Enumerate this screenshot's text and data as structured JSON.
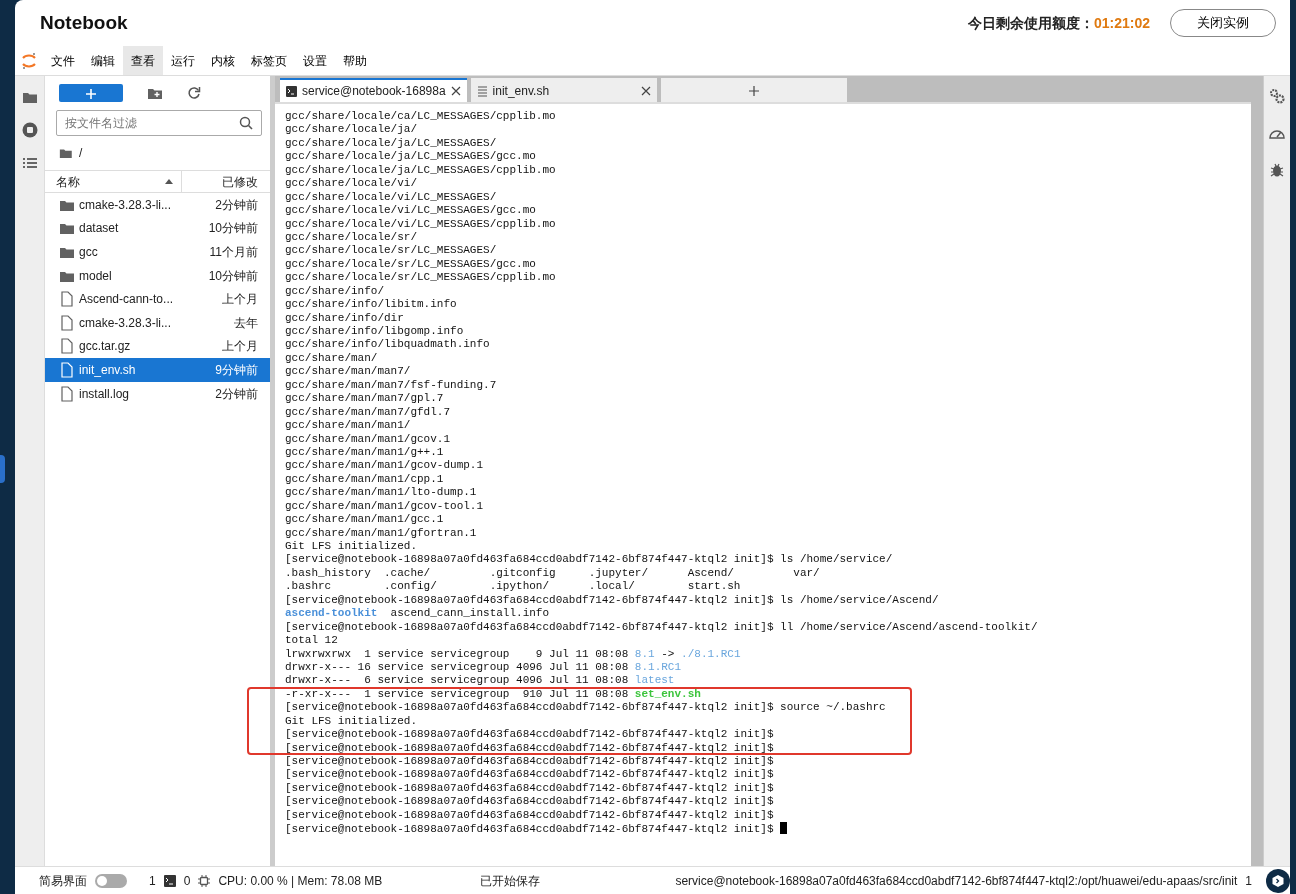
{
  "header": {
    "title": "Notebook",
    "quota_label": "今日剩余使用额度：",
    "quota_value": "01:21:02",
    "close_button": "关闭实例"
  },
  "menu": [
    {
      "label": "文件",
      "selected": false
    },
    {
      "label": "编辑",
      "selected": false
    },
    {
      "label": "查看",
      "selected": true
    },
    {
      "label": "运行",
      "selected": false
    },
    {
      "label": "内核",
      "selected": false
    },
    {
      "label": "标签页",
      "selected": false
    },
    {
      "label": "设置",
      "selected": false
    },
    {
      "label": "帮助",
      "selected": false
    }
  ],
  "file_browser": {
    "filter_placeholder": "按文件名过滤",
    "path": "/",
    "columns": [
      "名称",
      "已修改"
    ],
    "files": [
      {
        "name": "cmake-3.28.3-li...",
        "modified": "2分钟前",
        "kind": "folder",
        "selected": false
      },
      {
        "name": "dataset",
        "modified": "10分钟前",
        "kind": "folder",
        "selected": false
      },
      {
        "name": "gcc",
        "modified": "11个月前",
        "kind": "folder",
        "selected": false
      },
      {
        "name": "model",
        "modified": "10分钟前",
        "kind": "folder",
        "selected": false
      },
      {
        "name": "Ascend-cann-to...",
        "modified": "上个月",
        "kind": "file",
        "selected": false
      },
      {
        "name": "cmake-3.28.3-li...",
        "modified": "去年",
        "kind": "file",
        "selected": false
      },
      {
        "name": "gcc.tar.gz",
        "modified": "上个月",
        "kind": "file",
        "selected": false
      },
      {
        "name": "init_env.sh",
        "modified": "9分钟前",
        "kind": "file",
        "selected": true
      },
      {
        "name": "install.log",
        "modified": "2分钟前",
        "kind": "file",
        "selected": false
      }
    ]
  },
  "tabs": [
    {
      "label": "service@notebook-16898a",
      "kind": "terminal",
      "selected": true
    },
    {
      "label": "init_env.sh",
      "kind": "text",
      "selected": false
    }
  ],
  "terminal": {
    "cursor_visible": true,
    "lines": [
      {
        "highlighted": false,
        "parts": [
          {
            "text": "gcc/share/locale/ca/LC_MESSAGES/cpplib.mo",
            "kind": "plain"
          }
        ]
      },
      {
        "highlighted": false,
        "parts": [
          {
            "text": "gcc/share/locale/ja/",
            "kind": "plain"
          }
        ]
      },
      {
        "highlighted": false,
        "parts": [
          {
            "text": "gcc/share/locale/ja/LC_MESSAGES/",
            "kind": "plain"
          }
        ]
      },
      {
        "highlighted": false,
        "parts": [
          {
            "text": "gcc/share/locale/ja/LC_MESSAGES/gcc.mo",
            "kind": "plain"
          }
        ]
      },
      {
        "highlighted": false,
        "parts": [
          {
            "text": "gcc/share/locale/ja/LC_MESSAGES/cpplib.mo",
            "kind": "plain"
          }
        ]
      },
      {
        "highlighted": false,
        "parts": [
          {
            "text": "gcc/share/locale/vi/",
            "kind": "plain"
          }
        ]
      },
      {
        "highlighted": false,
        "parts": [
          {
            "text": "gcc/share/locale/vi/LC_MESSAGES/",
            "kind": "plain"
          }
        ]
      },
      {
        "highlighted": false,
        "parts": [
          {
            "text": "gcc/share/locale/vi/LC_MESSAGES/gcc.mo",
            "kind": "plain"
          }
        ]
      },
      {
        "highlighted": false,
        "parts": [
          {
            "text": "gcc/share/locale/vi/LC_MESSAGES/cpplib.mo",
            "kind": "plain"
          }
        ]
      },
      {
        "highlighted": false,
        "parts": [
          {
            "text": "gcc/share/locale/sr/",
            "kind": "plain"
          }
        ]
      },
      {
        "highlighted": false,
        "parts": [
          {
            "text": "gcc/share/locale/sr/LC_MESSAGES/",
            "kind": "plain"
          }
        ]
      },
      {
        "highlighted": false,
        "parts": [
          {
            "text": "gcc/share/locale/sr/LC_MESSAGES/gcc.mo",
            "kind": "plain"
          }
        ]
      },
      {
        "highlighted": false,
        "parts": [
          {
            "text": "gcc/share/locale/sr/LC_MESSAGES/cpplib.mo",
            "kind": "plain"
          }
        ]
      },
      {
        "highlighted": false,
        "parts": [
          {
            "text": "gcc/share/info/",
            "kind": "plain"
          }
        ]
      },
      {
        "highlighted": false,
        "parts": [
          {
            "text": "gcc/share/info/libitm.info",
            "kind": "plain"
          }
        ]
      },
      {
        "highlighted": false,
        "parts": [
          {
            "text": "gcc/share/info/dir",
            "kind": "plain"
          }
        ]
      },
      {
        "highlighted": false,
        "parts": [
          {
            "text": "gcc/share/info/libgomp.info",
            "kind": "plain"
          }
        ]
      },
      {
        "highlighted": false,
        "parts": [
          {
            "text": "gcc/share/info/libquadmath.info",
            "kind": "plain"
          }
        ]
      },
      {
        "highlighted": false,
        "parts": [
          {
            "text": "gcc/share/man/",
            "kind": "plain"
          }
        ]
      },
      {
        "highlighted": false,
        "parts": [
          {
            "text": "gcc/share/man/man7/",
            "kind": "plain"
          }
        ]
      },
      {
        "highlighted": false,
        "parts": [
          {
            "text": "gcc/share/man/man7/fsf-funding.7",
            "kind": "plain"
          }
        ]
      },
      {
        "highlighted": false,
        "parts": [
          {
            "text": "gcc/share/man/man7/gpl.7",
            "kind": "plain"
          }
        ]
      },
      {
        "highlighted": false,
        "parts": [
          {
            "text": "gcc/share/man/man7/gfdl.7",
            "kind": "plain"
          }
        ]
      },
      {
        "highlighted": false,
        "parts": [
          {
            "text": "gcc/share/man/man1/",
            "kind": "plain"
          }
        ]
      },
      {
        "highlighted": false,
        "parts": [
          {
            "text": "gcc/share/man/man1/gcov.1",
            "kind": "plain"
          }
        ]
      },
      {
        "highlighted": false,
        "parts": [
          {
            "text": "gcc/share/man/man1/g++.1",
            "kind": "plain"
          }
        ]
      },
      {
        "highlighted": false,
        "parts": [
          {
            "text": "gcc/share/man/man1/gcov-dump.1",
            "kind": "plain"
          }
        ]
      },
      {
        "highlighted": false,
        "parts": [
          {
            "text": "gcc/share/man/man1/cpp.1",
            "kind": "plain"
          }
        ]
      },
      {
        "highlighted": false,
        "parts": [
          {
            "text": "gcc/share/man/man1/lto-dump.1",
            "kind": "plain"
          }
        ]
      },
      {
        "highlighted": false,
        "parts": [
          {
            "text": "gcc/share/man/man1/gcov-tool.1",
            "kind": "plain"
          }
        ]
      },
      {
        "highlighted": false,
        "parts": [
          {
            "text": "gcc/share/man/man1/gcc.1",
            "kind": "plain"
          }
        ]
      },
      {
        "highlighted": false,
        "parts": [
          {
            "text": "gcc/share/man/man1/gfortran.1",
            "kind": "plain"
          }
        ]
      },
      {
        "highlighted": false,
        "parts": [
          {
            "text": "Git LFS initialized.",
            "kind": "plain"
          }
        ]
      },
      {
        "highlighted": false,
        "parts": [
          {
            "text": "[service@notebook-16898a07a0fd463fa684ccd0abdf7142-6bf874f447-ktql2 init]$ ls /home/service/",
            "kind": "plain"
          }
        ]
      },
      {
        "highlighted": false,
        "parts": [
          {
            "text": ".bash_history  .cache/         .gitconfig     .jupyter/      Ascend/         var/",
            "kind": "plain"
          }
        ]
      },
      {
        "highlighted": false,
        "parts": [
          {
            "text": ".bashrc        .config/        .ipython/      .local/        start.sh",
            "kind": "plain"
          }
        ]
      },
      {
        "highlighted": false,
        "parts": [
          {
            "text": "[service@notebook-16898a07a0fd463fa684ccd0abdf7142-6bf874f447-ktql2 init]$ ls /home/service/Ascend/",
            "kind": "plain"
          }
        ]
      },
      {
        "highlighted": false,
        "parts": [
          {
            "text": "ascend-toolkit",
            "kind": "dir"
          },
          {
            "text": "  ascend_cann_install.info",
            "kind": "plain"
          }
        ]
      },
      {
        "highlighted": false,
        "parts": [
          {
            "text": "[service@notebook-16898a07a0fd463fa684ccd0abdf7142-6bf874f447-ktql2 init]$ ll /home/service/Ascend/ascend-toolkit/",
            "kind": "plain"
          }
        ]
      },
      {
        "highlighted": false,
        "parts": [
          {
            "text": "total 12",
            "kind": "plain"
          }
        ]
      },
      {
        "highlighted": false,
        "parts": [
          {
            "text": "lrwxrwxrwx  1 service servicegroup    9 Jul 11 08:08 ",
            "kind": "plain"
          },
          {
            "text": "8.1",
            "kind": "link"
          },
          {
            "text": " -> ",
            "kind": "plain"
          },
          {
            "text": "./8.1.RC1",
            "kind": "link"
          }
        ]
      },
      {
        "highlighted": false,
        "parts": [
          {
            "text": "drwxr-x--- 16 service servicegroup 4096 Jul 11 08:08 ",
            "kind": "plain"
          },
          {
            "text": "8.1.RC1",
            "kind": "link"
          }
        ]
      },
      {
        "highlighted": false,
        "parts": [
          {
            "text": "drwxr-x---  6 service servicegroup 4096 Jul 11 08:08 ",
            "kind": "plain"
          },
          {
            "text": "latest",
            "kind": "link"
          }
        ]
      },
      {
        "highlighted": true,
        "parts": [
          {
            "text": "-r-xr-x---  1 service servicegroup  910 Jul 11 08:08 ",
            "kind": "plain"
          },
          {
            "text": "set_env.sh",
            "kind": "exec"
          }
        ]
      },
      {
        "highlighted": true,
        "parts": [
          {
            "text": "[service@notebook-16898a07a0fd463fa684ccd0abdf7142-6bf874f447-ktql2 init]$ source ~/.bashrc",
            "kind": "plain"
          }
        ]
      },
      {
        "highlighted": true,
        "parts": [
          {
            "text": "Git LFS initialized.",
            "kind": "plain"
          }
        ]
      },
      {
        "highlighted": true,
        "parts": [
          {
            "text": "[service@notebook-16898a07a0fd463fa684ccd0abdf7142-6bf874f447-ktql2 init]$",
            "kind": "plain"
          }
        ]
      },
      {
        "highlighted": true,
        "parts": [
          {
            "text": "[service@notebook-16898a07a0fd463fa684ccd0abdf7142-6bf874f447-ktql2 init]$",
            "kind": "plain"
          }
        ]
      },
      {
        "highlighted": false,
        "parts": [
          {
            "text": "[service@notebook-16898a07a0fd463fa684ccd0abdf7142-6bf874f447-ktql2 init]$",
            "kind": "plain"
          }
        ]
      },
      {
        "highlighted": false,
        "parts": [
          {
            "text": "[service@notebook-16898a07a0fd463fa684ccd0abdf7142-6bf874f447-ktql2 init]$",
            "kind": "plain"
          }
        ]
      },
      {
        "highlighted": false,
        "parts": [
          {
            "text": "[service@notebook-16898a07a0fd463fa684ccd0abdf7142-6bf874f447-ktql2 init]$",
            "kind": "plain"
          }
        ]
      },
      {
        "highlighted": false,
        "parts": [
          {
            "text": "[service@notebook-16898a07a0fd463fa684ccd0abdf7142-6bf874f447-ktql2 init]$",
            "kind": "plain"
          }
        ]
      },
      {
        "highlighted": false,
        "parts": [
          {
            "text": "[service@notebook-16898a07a0fd463fa684ccd0abdf7142-6bf874f447-ktql2 init]$",
            "kind": "plain"
          }
        ]
      },
      {
        "highlighted": false,
        "parts": [
          {
            "text": "[service@notebook-16898a07a0fd463fa684ccd0abdf7142-6bf874f447-ktql2 init]$",
            "kind": "plain"
          }
        ]
      }
    ]
  },
  "status_bar": {
    "simple_mode_label": "简易界面",
    "simple_mode_on": false,
    "terminals": "1",
    "kernels": "0",
    "resources": "CPU: 0.00 % | Mem: 78.08 MB",
    "save_status": "已开始保存",
    "path": "service@notebook-16898a07a0fd463fa684ccd0abdf7142-6bf874f447-ktql2:/opt/huawei/edu-apaas/src/init",
    "line": "1"
  }
}
